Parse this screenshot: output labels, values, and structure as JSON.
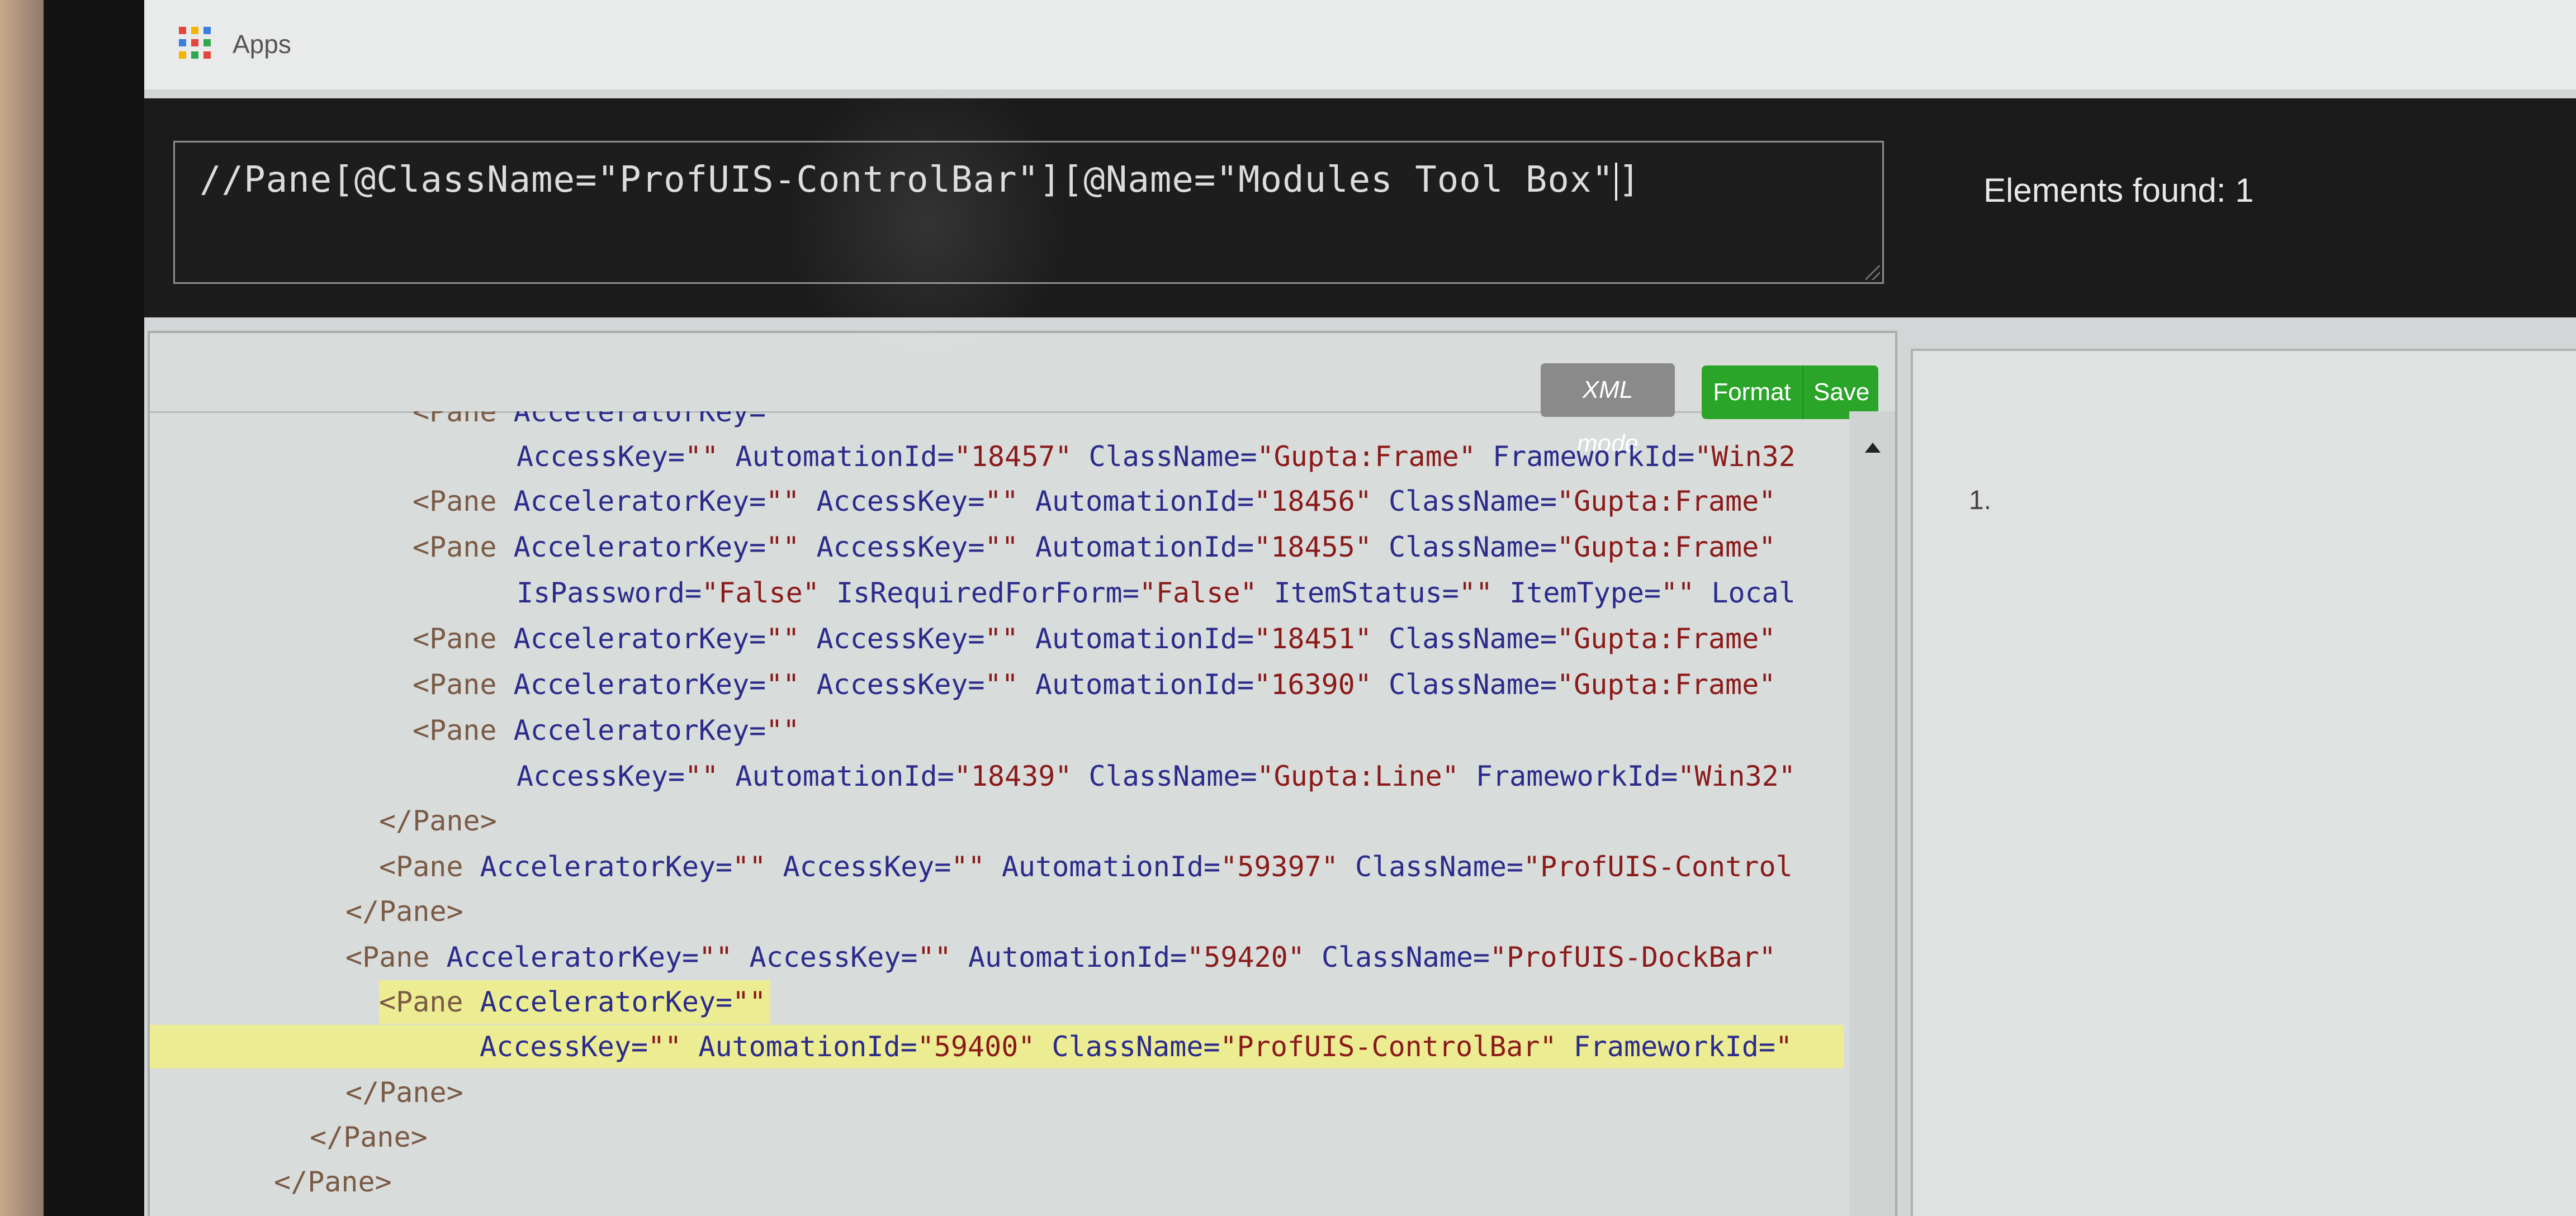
{
  "appsbar": {
    "label": "Apps"
  },
  "query": {
    "text_before_caret": "//Pane[@ClassName=\"ProfUIS-ControlBar\"][@Name=\"Modules Tool Box\"",
    "text_after_caret": "]",
    "elements_found": "Elements found: 1"
  },
  "toolbar": {
    "xml_mode": "XML mode",
    "format": "Format",
    "save": "Save"
  },
  "code_lines": [
    [
      [
        "tag",
        "<Pane "
      ],
      [
        "attr",
        "AcceleratorKey="
      ],
      [
        "val",
        "\"\""
      ]
    ],
    [
      [
        "attr",
        "AccessKey="
      ],
      [
        "val",
        "\"\" "
      ],
      [
        "attr",
        "AutomationId="
      ],
      [
        "val",
        "\"18457\" "
      ],
      [
        "attr",
        "ClassName="
      ],
      [
        "val",
        "\"Gupta:Frame\" "
      ],
      [
        "attr",
        "FrameworkId="
      ],
      [
        "val",
        "\"Win32"
      ]
    ],
    [
      [
        "tag",
        "<Pane "
      ],
      [
        "attr",
        "AcceleratorKey="
      ],
      [
        "val",
        "\"\" "
      ],
      [
        "attr",
        "AccessKey="
      ],
      [
        "val",
        "\"\" "
      ],
      [
        "attr",
        "AutomationId="
      ],
      [
        "val",
        "\"18456\" "
      ],
      [
        "attr",
        "ClassName="
      ],
      [
        "val",
        "\"Gupta:Frame\""
      ]
    ],
    [
      [
        "tag",
        "<Pane "
      ],
      [
        "attr",
        "AcceleratorKey="
      ],
      [
        "val",
        "\"\" "
      ],
      [
        "attr",
        "AccessKey="
      ],
      [
        "val",
        "\"\" "
      ],
      [
        "attr",
        "AutomationId="
      ],
      [
        "val",
        "\"18455\" "
      ],
      [
        "attr",
        "ClassName="
      ],
      [
        "val",
        "\"Gupta:Frame\""
      ]
    ],
    [
      [
        "attr",
        "IsPassword="
      ],
      [
        "val",
        "\"False\" "
      ],
      [
        "attr",
        "IsRequiredForForm="
      ],
      [
        "val",
        "\"False\" "
      ],
      [
        "attr",
        "ItemStatus="
      ],
      [
        "val",
        "\"\" "
      ],
      [
        "attr",
        "ItemType="
      ],
      [
        "val",
        "\"\" "
      ],
      [
        "attr",
        "Local"
      ]
    ],
    [
      [
        "tag",
        "<Pane "
      ],
      [
        "attr",
        "AcceleratorKey="
      ],
      [
        "val",
        "\"\" "
      ],
      [
        "attr",
        "AccessKey="
      ],
      [
        "val",
        "\"\" "
      ],
      [
        "attr",
        "AutomationId="
      ],
      [
        "val",
        "\"18451\" "
      ],
      [
        "attr",
        "ClassName="
      ],
      [
        "val",
        "\"Gupta:Frame\""
      ]
    ],
    [
      [
        "tag",
        "<Pane "
      ],
      [
        "attr",
        "AcceleratorKey="
      ],
      [
        "val",
        "\"\" "
      ],
      [
        "attr",
        "AccessKey="
      ],
      [
        "val",
        "\"\" "
      ],
      [
        "attr",
        "AutomationId="
      ],
      [
        "val",
        "\"16390\" "
      ],
      [
        "attr",
        "ClassName="
      ],
      [
        "val",
        "\"Gupta:Frame\""
      ]
    ],
    [
      [
        "tag",
        "<Pane "
      ],
      [
        "attr",
        "AcceleratorKey="
      ],
      [
        "val",
        "\"\""
      ]
    ],
    [
      [
        "attr",
        "AccessKey="
      ],
      [
        "val",
        "\"\" "
      ],
      [
        "attr",
        "AutomationId="
      ],
      [
        "val",
        "\"18439\" "
      ],
      [
        "attr",
        "ClassName="
      ],
      [
        "val",
        "\"Gupta:Line\" "
      ],
      [
        "attr",
        "FrameworkId="
      ],
      [
        "val",
        "\"Win32\""
      ]
    ],
    [
      [
        "tag",
        "</Pane>"
      ]
    ],
    [
      [
        "tag",
        "<Pane "
      ],
      [
        "attr",
        "AcceleratorKey="
      ],
      [
        "val",
        "\"\" "
      ],
      [
        "attr",
        "AccessKey="
      ],
      [
        "val",
        "\"\" "
      ],
      [
        "attr",
        "AutomationId="
      ],
      [
        "val",
        "\"59397\" "
      ],
      [
        "attr",
        "ClassName="
      ],
      [
        "val",
        "\"ProfUIS-Control"
      ]
    ],
    [
      [
        "tag",
        "</Pane>"
      ]
    ],
    [
      [
        "tag",
        "<Pane "
      ],
      [
        "attr",
        "AcceleratorKey="
      ],
      [
        "val",
        "\"\" "
      ],
      [
        "attr",
        "AccessKey="
      ],
      [
        "val",
        "\"\" "
      ],
      [
        "attr",
        "AutomationId="
      ],
      [
        "val",
        "\"59420\" "
      ],
      [
        "attr",
        "ClassName="
      ],
      [
        "val",
        "\"ProfUIS-DockBar\""
      ]
    ],
    [
      [
        "tag",
        "<Pane "
      ],
      [
        "attr",
        "AcceleratorKey="
      ],
      [
        "val",
        "\"\""
      ]
    ],
    [
      [
        "attr",
        "AccessKey="
      ],
      [
        "val",
        "\"\" "
      ],
      [
        "attr",
        "AutomationId="
      ],
      [
        "val",
        "\"59400\" "
      ],
      [
        "attr",
        "ClassName="
      ],
      [
        "val",
        "\"ProfUIS-ControlBar\" "
      ],
      [
        "attr",
        "FrameworkId="
      ],
      [
        "val",
        "\""
      ]
    ],
    [
      [
        "tag",
        "</Pane>"
      ]
    ],
    [
      [
        "tag",
        "</Pane>"
      ]
    ],
    [
      [
        "tag",
        "</Pane>"
      ]
    ]
  ],
  "results": {
    "item_1": "1."
  }
}
